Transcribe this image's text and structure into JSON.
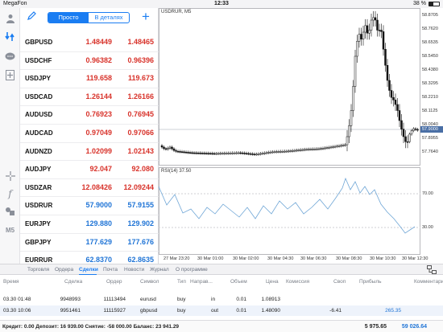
{
  "status_bar": {
    "carrier": "MegaFon",
    "time": "12:33",
    "battery": "38 %",
    "battery_level": 0.38
  },
  "left_rail": {
    "icons": [
      "user-icon",
      "quotes-icon",
      "chat-icon",
      "new-order-icon",
      "crosshair-icon",
      "function-icon",
      "objects-icon",
      "timeframe-icon"
    ],
    "timeframe": "M5"
  },
  "quotes_panel": {
    "edit_icon": "pencil-icon",
    "segment": {
      "simple": "Просто",
      "detailed": "В деталях",
      "selected": "simple"
    },
    "add_icon": "plus-icon",
    "rows": [
      {
        "symbol": "GBPUSD",
        "bid": "1.48449",
        "ask": "1.48465",
        "color": "red"
      },
      {
        "symbol": "USDCHF",
        "bid": "0.96382",
        "ask": "0.96396",
        "color": "red"
      },
      {
        "symbol": "USDJPY",
        "bid": "119.658",
        "ask": "119.673",
        "color": "red"
      },
      {
        "symbol": "USDCAD",
        "bid": "1.26144",
        "ask": "1.26166",
        "color": "red"
      },
      {
        "symbol": "AUDUSD",
        "bid": "0.76923",
        "ask": "0.76945",
        "color": "red"
      },
      {
        "symbol": "AUDCAD",
        "bid": "0.97049",
        "ask": "0.97066",
        "color": "red"
      },
      {
        "symbol": "AUDNZD",
        "bid": "1.02099",
        "ask": "1.02143",
        "color": "red"
      },
      {
        "symbol": "AUDJPY",
        "bid": "92.047",
        "ask": "92.080",
        "color": "red"
      },
      {
        "symbol": "USDZAR",
        "bid": "12.08426",
        "ask": "12.09244",
        "color": "red"
      },
      {
        "symbol": "USDRUR",
        "bid": "57.9000",
        "ask": "57.9155",
        "color": "blue"
      },
      {
        "symbol": "EURJPY",
        "bid": "129.880",
        "ask": "129.902",
        "color": "blue"
      },
      {
        "symbol": "GBPJPY",
        "bid": "177.629",
        "ask": "177.676",
        "color": "blue"
      },
      {
        "symbol": "EURRUR",
        "bid": "62.8370",
        "ask": "62.8635",
        "color": "blue"
      }
    ]
  },
  "chart": {
    "title": "USDRUR, M5",
    "indicator_title": "RSI(14) 37.50",
    "current_price": "57.9000",
    "price_labels": [
      "58.8705",
      "58.7620",
      "58.6535",
      "58.5450",
      "58.4380",
      "58.3295",
      "58.2210",
      "58.1125",
      "58.0040",
      "57.8955",
      "57.7640"
    ],
    "rsi_labels": [
      "70.00",
      "30.00"
    ],
    "time_labels": [
      "27 Mar 23:20",
      "30 Mar 01:00",
      "30 Mar 02:00",
      "30 Mar 04:30",
      "30 Mar 06:30",
      "30 Mar 08:30",
      "30 Mar 10:30",
      "30 Mar 12:30"
    ]
  },
  "bottom_tabs": {
    "items": [
      "Торговля",
      "Ордера",
      "Сделки",
      "Почта",
      "Новости",
      "Журнал",
      "О программе"
    ],
    "selected": "Сделки",
    "layout_icon": "layout-icon"
  },
  "deals_table": {
    "headers": [
      "Время",
      "Сделка",
      "Ордер",
      "Символ",
      "Тип",
      "Направ...",
      "Объем",
      "Цена",
      "Комиссия",
      "Своп",
      "Прибыль",
      "Комментарий"
    ],
    "rows": [
      {
        "time": "03.30 01:48",
        "deal": "9948993",
        "order": "11113494",
        "symbol": "eurusd",
        "type": "buy",
        "direction": "in",
        "volume": "0.01",
        "price": "1.08913",
        "commission": "",
        "swap": "",
        "profit": "",
        "comment": ""
      },
      {
        "time": "03.30 10:06",
        "deal": "9951461",
        "order": "11115927",
        "symbol": "gbpusd",
        "type": "buy",
        "direction": "out",
        "volume": "0.01",
        "price": "1.48090",
        "commission": "",
        "swap": "-6.41",
        "profit": "265.35",
        "comment": ""
      }
    ]
  },
  "footer": {
    "summary": "Кредит: 0.00 Депозит: 16 939.00 Снятие: -58 000.00 Баланс: 23 941.29",
    "value1": "5 975.65",
    "value2": "59 026.64"
  }
}
